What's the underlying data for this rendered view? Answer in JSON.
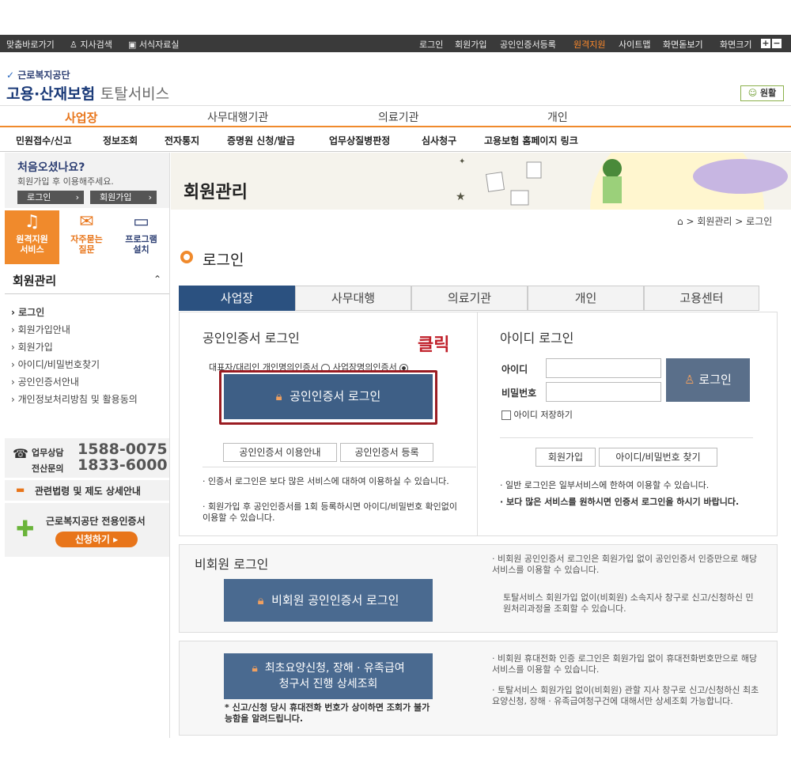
{
  "topbar": {
    "left": [
      "맞춤바로가기",
      "지사검색",
      "서식자료실"
    ],
    "right": [
      "로그인",
      "회원가입",
      "공인인증서등록",
      "원격지원",
      "사이트맵",
      "화면돋보기"
    ],
    "zoom": "화면크기"
  },
  "logo": {
    "org": "근로복지공단",
    "main": "고용·산재보험",
    "sub": "토탈서비스",
    "helper": "원활"
  },
  "gnb": [
    "사업장",
    "사무대행기관",
    "의료기관",
    "개인"
  ],
  "lnb": [
    "민원접수/신고",
    "정보조회",
    "전자통지",
    "증명원 신청/발급",
    "업무상질병판정",
    "심사청구",
    "고용보험 홈페이지 링크"
  ],
  "welcome": {
    "title": "처음오셨나요?",
    "desc": "회원가입 후 이용해주세요.",
    "login": "로그인",
    "join": "회원가입"
  },
  "quick": [
    {
      "label": "원격지원 서비스"
    },
    {
      "label": "자주묻는 질문"
    },
    {
      "label": "프로그램 설치"
    }
  ],
  "sidemenu": {
    "title": "회원관리",
    "items": [
      "로그인",
      "회원가입안내",
      "회원가입",
      "아이디/비밀번호찾기",
      "공인인증서안내",
      "개인정보처리방침 및 활용동의"
    ]
  },
  "contact": {
    "l1": "업무상담",
    "n1": "1588-0075",
    "l2": "전산문의",
    "n2": "1833-6000",
    "law": "관련법령 및 제도 상세안내",
    "cert": "근로복지공단 전용인증서",
    "apply": "신청하기"
  },
  "banner": {
    "title": "회원관리"
  },
  "breadcrumb": [
    "회원관리",
    "로그인"
  ],
  "page": {
    "title": "로그인"
  },
  "tabs": [
    "사업장",
    "사무대행",
    "의료기관",
    "개인",
    "고용센터"
  ],
  "cert": {
    "title": "공인인증서 로그인",
    "click": "클릭",
    "opt1": "대표자/대리인 개인명의인증서",
    "opt2": "사업장명의인증서",
    "btn": "공인인증서 로그인",
    "guide": "공인인증서 이용안내",
    "reg": "공인인증서 등록",
    "n1": "인증서 로그인은 보다 많은 서비스에 대하여 이용하실 수 있습니다.",
    "n2": "회원가입 후 공인인증서를 1회 등록하시면 아이디/비밀번호 확인없이 이용할 수 있습니다."
  },
  "id": {
    "title": "아이디 로그인",
    "id": "아이디",
    "pw": "비밀번호",
    "btn": "로그인",
    "save": "아이디 저장하기",
    "join": "회원가입",
    "find": "아이디/비밀번호 찾기",
    "n1": "일반 로그인은 일부서비스에 한하여 이용할 수 있습니다.",
    "n2": "보다 많은 서비스를 원하시면 인증서 로그인을 하시기 바랍니다."
  },
  "nonmember": {
    "title": "비회원 로그인",
    "btn": "비회원 공인인증서 로그인",
    "n1": "비회원 공인인증서 로그인은 회원가입 없이 공인인증서 인증만으로 해당 서비스를 이용할 수 있습니다.",
    "n2": "토탈서비스 회원가입 없이(비회원) 소속지사 창구로 신고/신청하신 민원처리과정을 조회할 수 있습니다."
  },
  "phone": {
    "btn1": "최초요양신청, 장해 · 유족급여",
    "btn2": "청구서 진행 상세조회",
    "warn": "* 신고/신청 당시 휴대전화 번호가 상이하면 조회가 불가능함을 알려드립니다.",
    "n1": "비회원 휴대전화 인증 로그인은 회원가입 없이 휴대전화번호만으로 해당 서비스를 이용할 수 있습니다.",
    "n2": "토탈서비스 회원가입 없이(비회원) 관할 지사 창구로 신고/신청하신 최초요양신청, 장해 · 유족급여청구건에 대해서만 상세조회 가능합니다."
  }
}
